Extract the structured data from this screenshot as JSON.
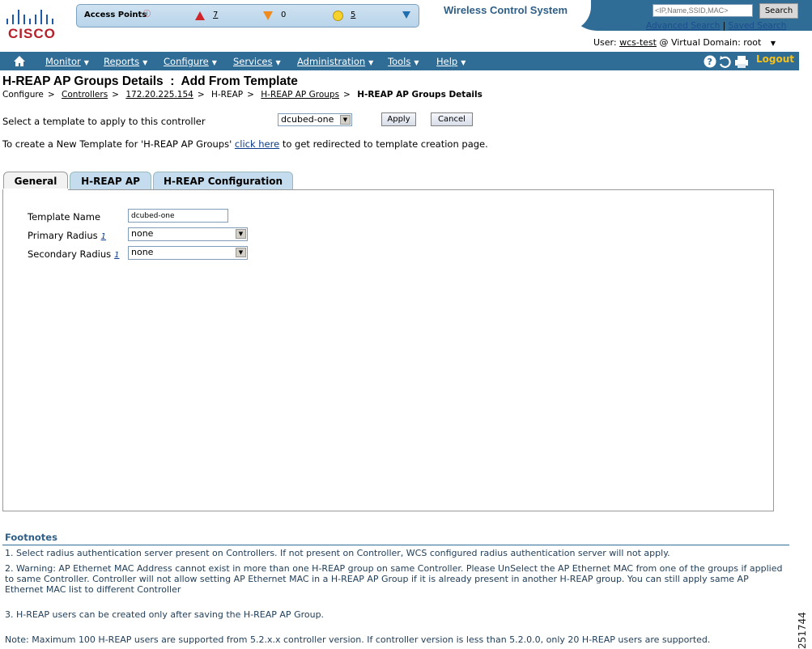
{
  "brand": {
    "logo_text": "CISCO",
    "app_title": "Wireless Control System"
  },
  "ap_summary": {
    "title": "Access Points",
    "critical_count": "7",
    "major_count": "0",
    "minor_count": "5"
  },
  "header": {
    "search_placeholder": "<IP,Name,SSID,MAC>",
    "search_button": "Search",
    "advanced_search": "Advanced Search",
    "separator": "|",
    "saved_search": "Saved Search",
    "user_label": "User:",
    "user_name": "wcs-test",
    "domain_label": "@ Virtual Domain:",
    "domain_value": "root"
  },
  "nav": {
    "items": [
      "Monitor",
      "Reports",
      "Configure",
      "Services",
      "Administration",
      "Tools",
      "Help"
    ],
    "logout": "Logout"
  },
  "page": {
    "title": "H-REAP AP Groups Details  :  Add From Template",
    "breadcrumb": [
      "Configure",
      "Controllers",
      "172.20.225.154",
      "H-REAP",
      "H-REAP AP Groups",
      "H-REAP AP Groups Details"
    ],
    "breadcrumb_sep": ">",
    "select_label": "Select a template to apply to this controller",
    "template_value": "dcubed-one",
    "apply_button": "Apply",
    "cancel_button": "Cancel",
    "create_prefix": "To create a New Template for 'H-REAP AP Groups'",
    "create_link": "click here",
    "create_suffix": "to get redirected to template creation page."
  },
  "tabs": [
    "General",
    "H-REAP AP",
    "H-REAP Configuration"
  ],
  "form": {
    "template_name_label": "Template Name",
    "template_name_value": "dcubed-one",
    "primary_radius_label": "Primary Radius",
    "primary_radius_value": "none",
    "secondary_radius_label": "Secondary Radius",
    "secondary_radius_value": "none",
    "footnote_ref": "1"
  },
  "footnotes": {
    "title": "Footnotes",
    "items": [
      "1. Select radius authentication server present on Controllers. If not present on Controller, WCS configured radius authentication server will not apply.",
      "2. Warning: AP Ethernet MAC Address cannot exist in more than one H-REAP group on same Controller. Please UnSelect the AP Ethernet MAC from one of the groups if applied to same Controller. Controller will not allow setting AP Ethernet MAC in a H-REAP AP Group if it is already present in another H-REAP group. You can still apply same AP Ethernet MAC list to different Controller",
      "3. H-REAP users can be created only after saving the H-REAP AP Group.",
      "Note: Maximum 100 H-REAP users are supported from 5.2.x.x controller version. If controller version is less than 5.2.0.0, only 20 H-REAP users are supported."
    ]
  },
  "figure_number": "251744",
  "colors": {
    "nav_bg": "#2f6c96",
    "logo_red": "#b6202a",
    "link": "#0b3a8c",
    "logout": "#f6c21a"
  }
}
